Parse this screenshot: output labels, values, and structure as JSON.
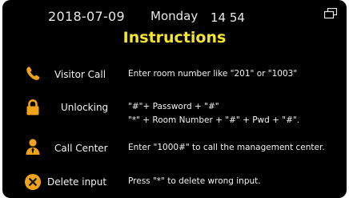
{
  "header": {
    "date": "2018-07-09",
    "weekday": "Monday",
    "time": "14 54"
  },
  "title": "Instructions",
  "colors": {
    "background": "#000000",
    "title": "#f5e52a",
    "icon": "#f0a21b",
    "text": "#f2f2f2"
  },
  "rows": [
    {
      "icon": "phone-icon",
      "label": "Visitor Call",
      "lines": [
        "Enter room number like \"201\" or \"1003\""
      ]
    },
    {
      "icon": "lock-icon",
      "label": "Unlocking",
      "lines": [
        "\"#\"+ Password + \"#\"",
        "\"*\" + Room Number + \"#\" + Pwd + \"#\"."
      ]
    },
    {
      "icon": "user-icon",
      "label": "Call Center",
      "lines": [
        "Enter \"1000#\" to call the management center."
      ]
    },
    {
      "icon": "close-circle-icon",
      "label": "Delete input",
      "lines": [
        "Press \"*\" to delete wrong input."
      ]
    }
  ]
}
